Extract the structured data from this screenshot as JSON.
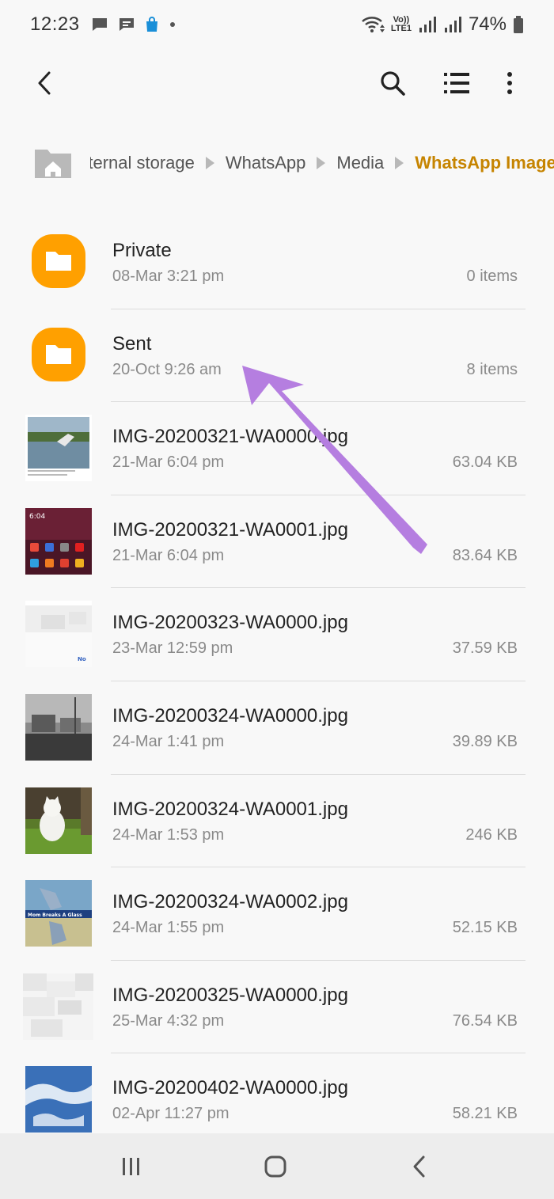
{
  "status_bar": {
    "time": "12:23",
    "volte_line1": "Vo))",
    "volte_line2": "LTE1",
    "battery_percent": "74%",
    "left_icons": [
      "message-icon",
      "chat-icon",
      "shopping-bag-icon",
      "dot-icon"
    ],
    "right_icons": [
      "wifi-icon",
      "signal-icon",
      "signal-icon",
      "battery-icon"
    ]
  },
  "toolbar": {
    "back_icon": "back-arrow-icon",
    "search_icon": "search-icon",
    "list_view_icon": "list-view-icon",
    "more_icon": "more-vert-icon"
  },
  "breadcrumb": {
    "home_icon": "home-folder-icon",
    "items": [
      "Internal storage",
      "WhatsApp",
      "Media"
    ],
    "current": "WhatsApp Images",
    "current_color": "#c68400"
  },
  "files": [
    {
      "name": "Private",
      "date": "08-Mar 3:21 pm",
      "meta": "0 items",
      "type": "folder"
    },
    {
      "name": "Sent",
      "date": "20-Oct 9:26 am",
      "meta": "8 items",
      "type": "folder"
    },
    {
      "name": "IMG-20200321-WA0000.jpg",
      "date": "21-Mar 6:04 pm",
      "meta": "63.04 KB",
      "type": "image"
    },
    {
      "name": "IMG-20200321-WA0001.jpg",
      "date": "21-Mar 6:04 pm",
      "meta": "83.64 KB",
      "type": "image"
    },
    {
      "name": "IMG-20200323-WA0000.jpg",
      "date": "23-Mar 12:59 pm",
      "meta": "37.59 KB",
      "type": "image"
    },
    {
      "name": "IMG-20200324-WA0000.jpg",
      "date": "24-Mar 1:41 pm",
      "meta": "39.89 KB",
      "type": "image"
    },
    {
      "name": "IMG-20200324-WA0001.jpg",
      "date": "24-Mar 1:53 pm",
      "meta": "246 KB",
      "type": "image"
    },
    {
      "name": "IMG-20200324-WA0002.jpg",
      "date": "24-Mar 1:55 pm",
      "meta": "52.15 KB",
      "type": "image"
    },
    {
      "name": "IMG-20200325-WA0000.jpg",
      "date": "25-Mar 4:32 pm",
      "meta": "76.54 KB",
      "type": "image"
    },
    {
      "name": "IMG-20200402-WA0000.jpg",
      "date": "02-Apr 11:27 pm",
      "meta": "58.21 KB",
      "type": "image"
    }
  ],
  "thumbnail_texts": {
    "phone_clock": "6:04",
    "dialog_button": "No",
    "meme_caption": "Mom Breaks A Glass"
  },
  "colors": {
    "folder": "#ffa000",
    "accent": "#c68400",
    "annotation_arrow": "#b57ee0",
    "background": "#f8f8f8",
    "nav_bar": "#ededed"
  },
  "nav_bar": {
    "recents_icon": "recents-icon",
    "home_icon": "home-icon",
    "back_icon": "back-icon"
  }
}
